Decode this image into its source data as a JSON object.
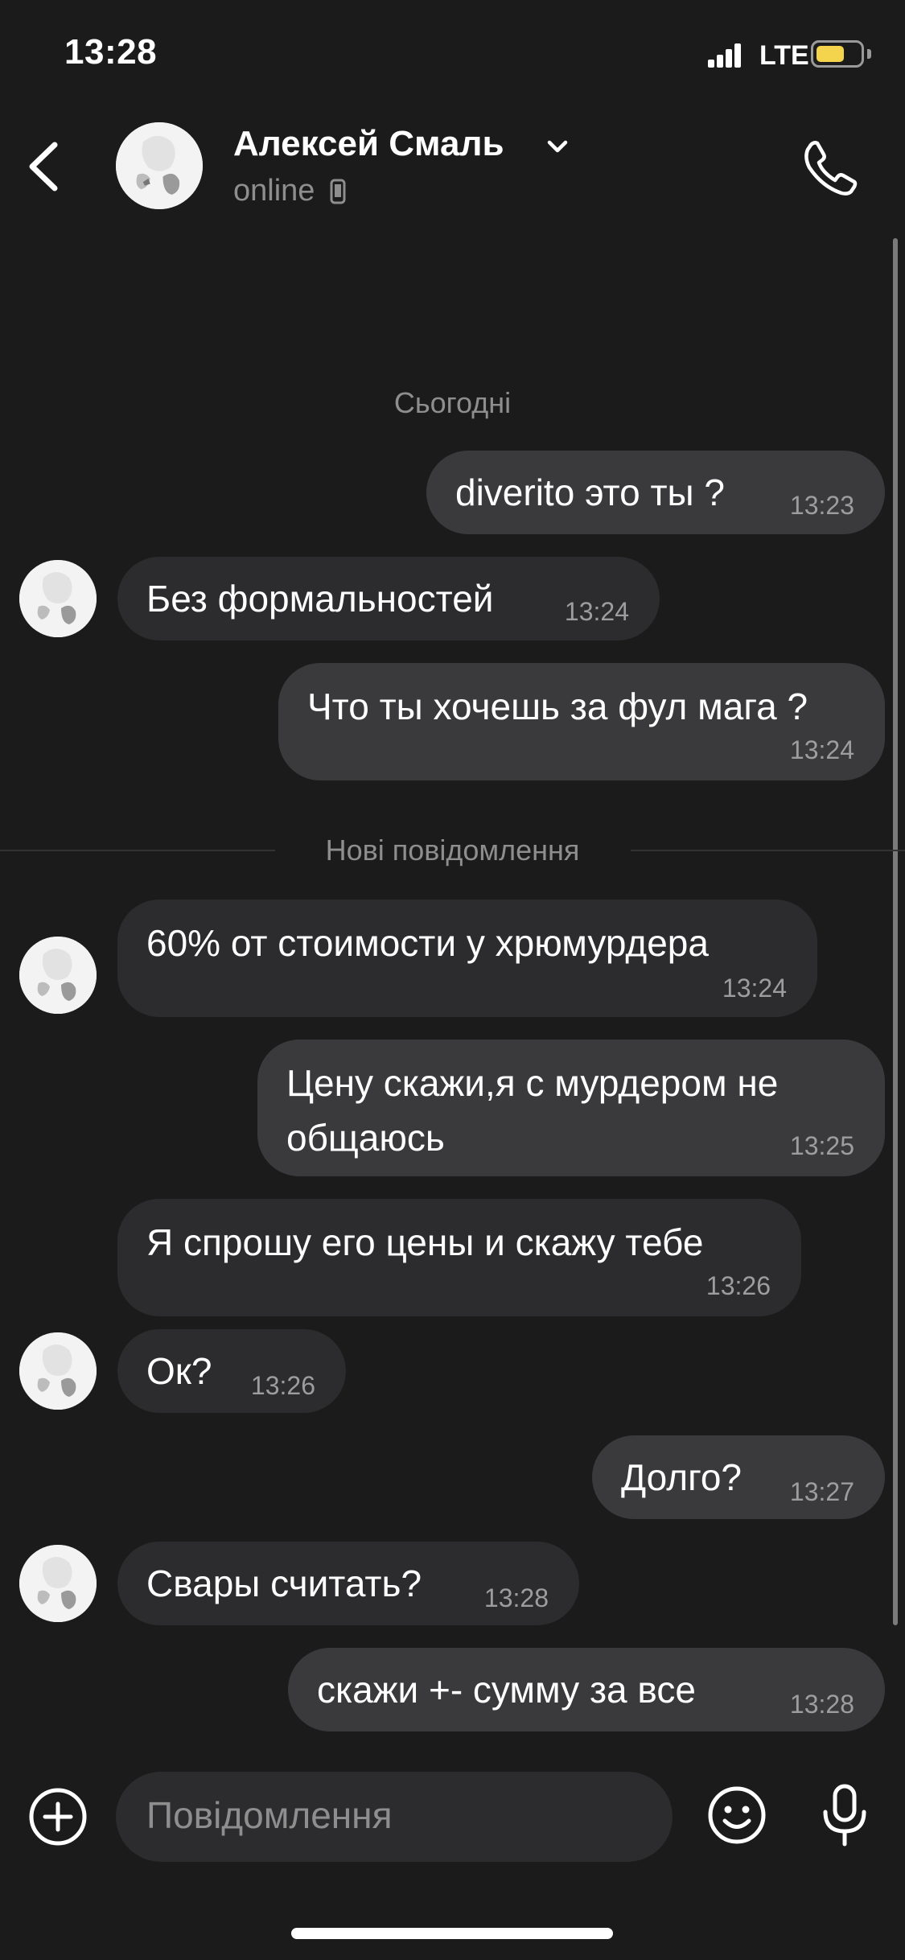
{
  "status_bar": {
    "time": "13:28",
    "network": "LTE",
    "battery_color": "#f4d34d",
    "battery_level": 0.65
  },
  "header": {
    "contact_name": "Алексей Смаль",
    "presence": "online",
    "icons": [
      "back-icon",
      "chevron-down-icon",
      "mobile-device-icon",
      "phone-icon"
    ]
  },
  "date_label": "Сьогодні",
  "new_messages_label": "Нові повідомлення",
  "messages": [
    {
      "text": "diverito это ты ?",
      "time": "13:23",
      "direction": "outgoing"
    },
    {
      "text": "Без формальностей",
      "time": "13:24",
      "direction": "incoming"
    },
    {
      "text": "Что ты хочешь за фул мага ?",
      "time": "13:24",
      "direction": "outgoing"
    },
    {
      "text": "60% от стоимости у хрюмурдера",
      "time": "13:24",
      "direction": "incoming"
    },
    {
      "text": "Цену скажи,я с мурдером не общаюсь",
      "time": "13:25",
      "direction": "outgoing"
    },
    {
      "text": "Я спрошу его цены и скажу тебе",
      "time": "13:26",
      "direction": "incoming"
    },
    {
      "text": "Ок?",
      "time": "13:26",
      "direction": "incoming"
    },
    {
      "text": "Долго?",
      "time": "13:27",
      "direction": "outgoing"
    },
    {
      "text": "Свары считать?",
      "time": "13:28",
      "direction": "incoming"
    },
    {
      "text": "скажи +- сумму за все",
      "time": "13:28",
      "direction": "outgoing"
    }
  ],
  "composer": {
    "placeholder": "Повідомлення",
    "icons": [
      "add-attachment-icon",
      "emoji-icon",
      "microphone-icon"
    ]
  }
}
